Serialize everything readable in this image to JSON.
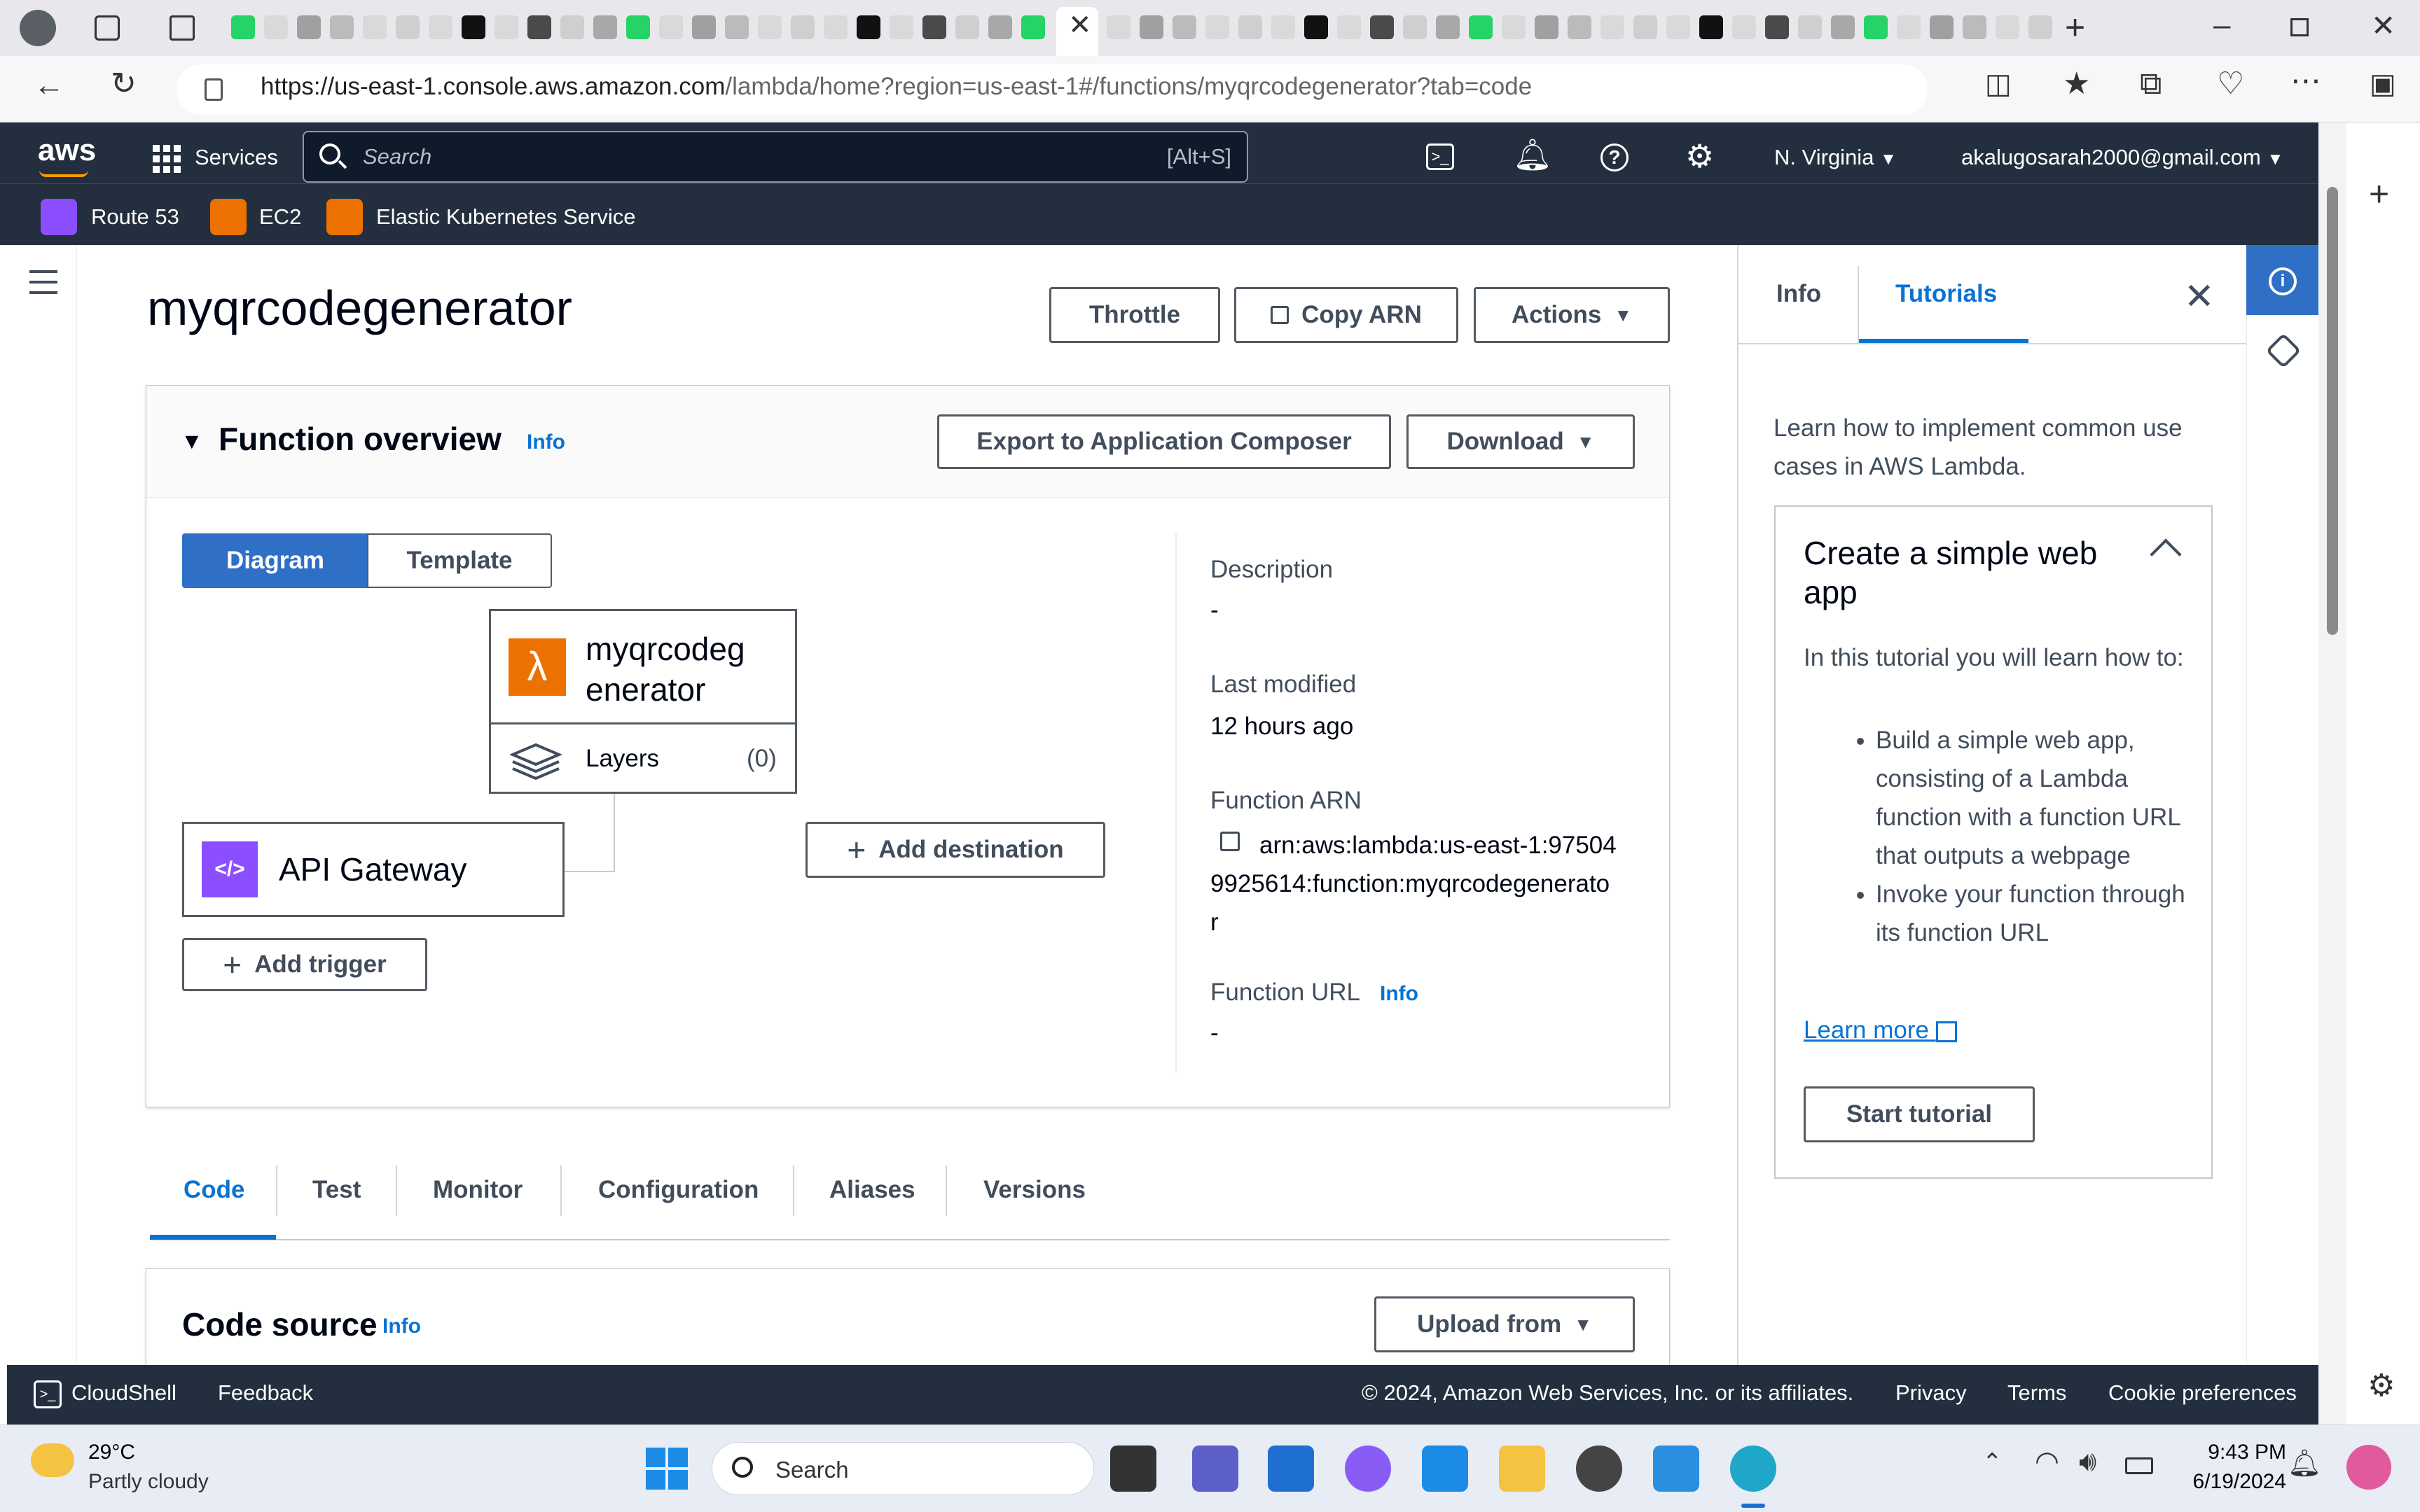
{
  "browser": {
    "url_domain": "https://us-east-1.console.aws.amazon.com",
    "url_path": "/lambda/home?region=us-east-1#/functions/myqrcodegenerator?tab=code"
  },
  "aws_header": {
    "logo": "aws",
    "services": "Services",
    "search_placeholder": "Search",
    "search_shortcut": "[Alt+S]",
    "region": "N. Virginia",
    "account": "akalugosarah2000@gmail.com",
    "favorites": [
      {
        "label": "Route 53",
        "color": "#8c4fff"
      },
      {
        "label": "EC2",
        "color": "#ed7100"
      },
      {
        "label": "Elastic Kubernetes Service",
        "color": "#ed7100"
      }
    ]
  },
  "page": {
    "title": "myqrcodegenerator",
    "buttons": {
      "throttle": "Throttle",
      "copy_arn": "Copy ARN",
      "actions": "Actions"
    }
  },
  "overview": {
    "heading": "Function overview",
    "info": "Info",
    "export_button": "Export to Application Composer",
    "download_button": "Download",
    "view_toggle": {
      "diagram": "Diagram",
      "template": "Template"
    },
    "function_name_line1": "myqrcodeg",
    "function_name_line2": "enerator",
    "layers_label": "Layers",
    "layers_count": "(0)",
    "trigger_label": "API Gateway",
    "add_trigger": "Add trigger",
    "add_destination": "Add destination",
    "description_label": "Description",
    "description_value": "-",
    "last_modified_label": "Last modified",
    "last_modified_value": "12 hours ago",
    "arn_label": "Function ARN",
    "arn_line1": "arn:aws:lambda:us-east-1:97504",
    "arn_line2": "9925614:function:myqrcodegenerato",
    "arn_line3": "r",
    "url_label": "Function URL",
    "url_info": "Info",
    "url_value": "-"
  },
  "tabs": [
    {
      "label": "Code",
      "active": true
    },
    {
      "label": "Test"
    },
    {
      "label": "Monitor"
    },
    {
      "label": "Configuration"
    },
    {
      "label": "Aliases"
    },
    {
      "label": "Versions"
    }
  ],
  "code_source": {
    "heading": "Code source",
    "info": "Info",
    "upload_button": "Upload from"
  },
  "help_panel": {
    "tab_info": "Info",
    "tab_tutorials": "Tutorials",
    "intro": "Learn how to implement common use cases in AWS Lambda.",
    "card_title": "Create a simple web app",
    "card_intro": "In this tutorial you will learn how to:",
    "bullets": [
      "Build a simple web app, consisting of a Lambda function with a function URL that outputs a webpage",
      "Invoke your function through its function URL"
    ],
    "learn_more": "Learn more",
    "start_button": "Start tutorial"
  },
  "footer": {
    "cloudshell": "CloudShell",
    "feedback": "Feedback",
    "copyright": "© 2024, Amazon Web Services, Inc. or its affiliates.",
    "privacy": "Privacy",
    "terms": "Terms",
    "cookies": "Cookie preferences"
  },
  "taskbar": {
    "temperature": "29°C",
    "weather": "Partly cloudy",
    "search_placeholder": "Search",
    "time": "9:43 PM",
    "date": "6/19/2024"
  },
  "colors": {
    "aws_nav": "#232f3e",
    "link_blue": "#0972d3",
    "primary_blue": "#2f6fc6",
    "lambda_orange": "#ed7100",
    "api_gateway_purple": "#8c4fff"
  }
}
